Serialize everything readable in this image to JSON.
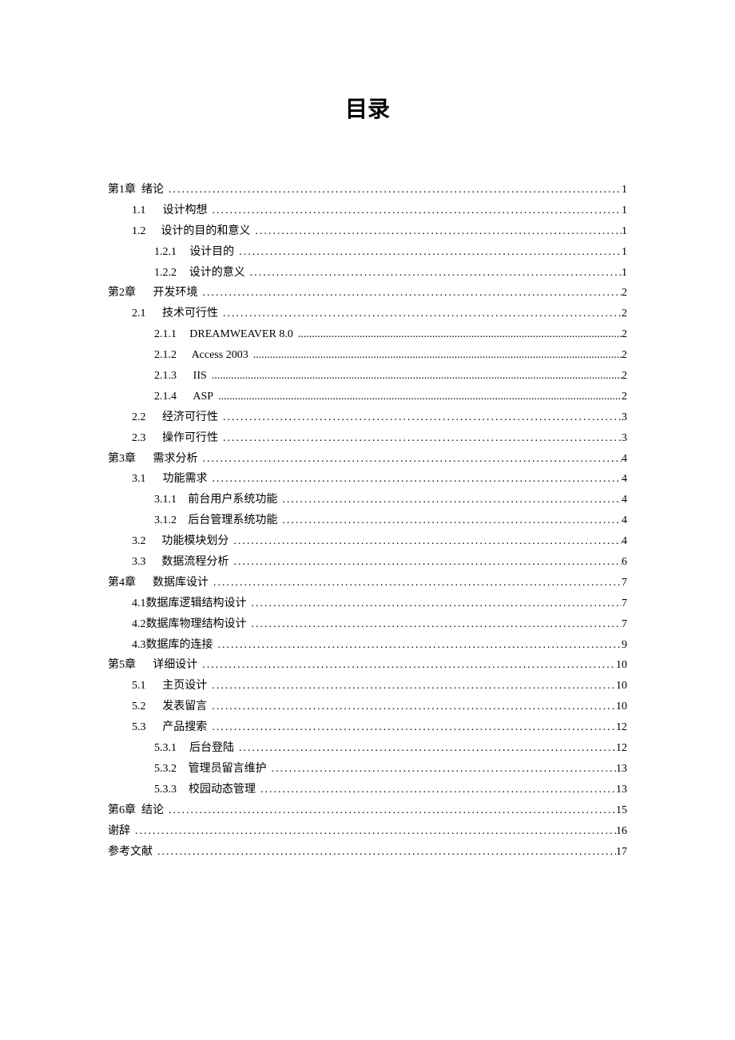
{
  "title": "目录",
  "toc": [
    {
      "level": 1,
      "num": "第1章",
      "gap": " ",
      "text": "绪论",
      "page": "1",
      "compact": true
    },
    {
      "level": 2,
      "num": "1.1",
      "text": "设计构想",
      "page": "1"
    },
    {
      "level": 2,
      "num": "1.2",
      "text": "设计的目的和意义",
      "page": "1"
    },
    {
      "level": 3,
      "num": "1.2.1",
      "text": "设计目的",
      "page": "1"
    },
    {
      "level": 3,
      "num": "1.2.2",
      "text": "设计的意义",
      "page": "1"
    },
    {
      "level": 1,
      "num": "第2章",
      "text": "开发环境",
      "page": "2"
    },
    {
      "level": 2,
      "num": "2.1",
      "text": "技术可行性",
      "page": "2"
    },
    {
      "level": 3,
      "num": "2.1.1",
      "text": "DREAMWEAVER 8.0",
      "page": "2",
      "alt_font": true
    },
    {
      "level": 3,
      "num": "2.1.2",
      "text": "Access 2003",
      "page": "2",
      "alt_font": true
    },
    {
      "level": 3,
      "num": "2.1.3",
      "text": "IIS",
      "page": "2",
      "alt_font": true
    },
    {
      "level": 3,
      "num": "2.1.4",
      "text": "ASP",
      "page": "2",
      "alt_font": true
    },
    {
      "level": 2,
      "num": "2.2",
      "text": "经济可行性",
      "page": "3"
    },
    {
      "level": 2,
      "num": "2.3",
      "text": "操作可行性",
      "page": "3"
    },
    {
      "level": 1,
      "num": "第3章",
      "text": "需求分析",
      "page": "4"
    },
    {
      "level": 2,
      "num": "3.1",
      "text": "功能需求",
      "page": "4"
    },
    {
      "level": 3,
      "num": "3.1.1",
      "text": "前台用户系统功能",
      "page": "4"
    },
    {
      "level": 3,
      "num": "3.1.2",
      "text": "后台管理系统功能",
      "page": "4"
    },
    {
      "level": 2,
      "num": "3.2",
      "text": "功能模块划分",
      "page": "4"
    },
    {
      "level": 2,
      "num": "3.3",
      "text": "数据流程分析",
      "page": "6"
    },
    {
      "level": 1,
      "num": "第4章",
      "text": "数据库设计",
      "page": "7"
    },
    {
      "level": 2,
      "num": "",
      "text": "4.1数据库逻辑结构设计",
      "page": "7",
      "no_gap": true
    },
    {
      "level": 2,
      "num": "",
      "text": "4.2数据库物理结构设计",
      "page": "7",
      "no_gap": true
    },
    {
      "level": 2,
      "num": "",
      "text": "4.3数据库的连接",
      "page": "9",
      "no_gap": true
    },
    {
      "level": 1,
      "num": "第5章",
      "text": "详细设计",
      "page": "10"
    },
    {
      "level": 2,
      "num": "5.1",
      "text": "主页设计",
      "page": "10"
    },
    {
      "level": 2,
      "num": "5.2",
      "text": "发表留言",
      "page": "10"
    },
    {
      "level": 2,
      "num": "5.3",
      "text": "产品搜索",
      "page": "12"
    },
    {
      "level": 3,
      "num": "5.3.1",
      "text": "后台登陆",
      "page": "12"
    },
    {
      "level": 3,
      "num": "5.3.2",
      "text": "管理员留言维护",
      "page": "13"
    },
    {
      "level": 3,
      "num": "5.3.3",
      "text": "校园动态管理",
      "page": "13"
    },
    {
      "level": 1,
      "num": "第6章",
      "gap": " ",
      "text": "结论",
      "page": "15",
      "compact": true
    },
    {
      "level": 1,
      "num": "",
      "text": "谢辞",
      "page": "16",
      "no_gap": true,
      "nonum": true
    },
    {
      "level": 1,
      "num": "",
      "text": "参考文献",
      "page": "17",
      "no_gap": true,
      "nonum": true
    }
  ]
}
